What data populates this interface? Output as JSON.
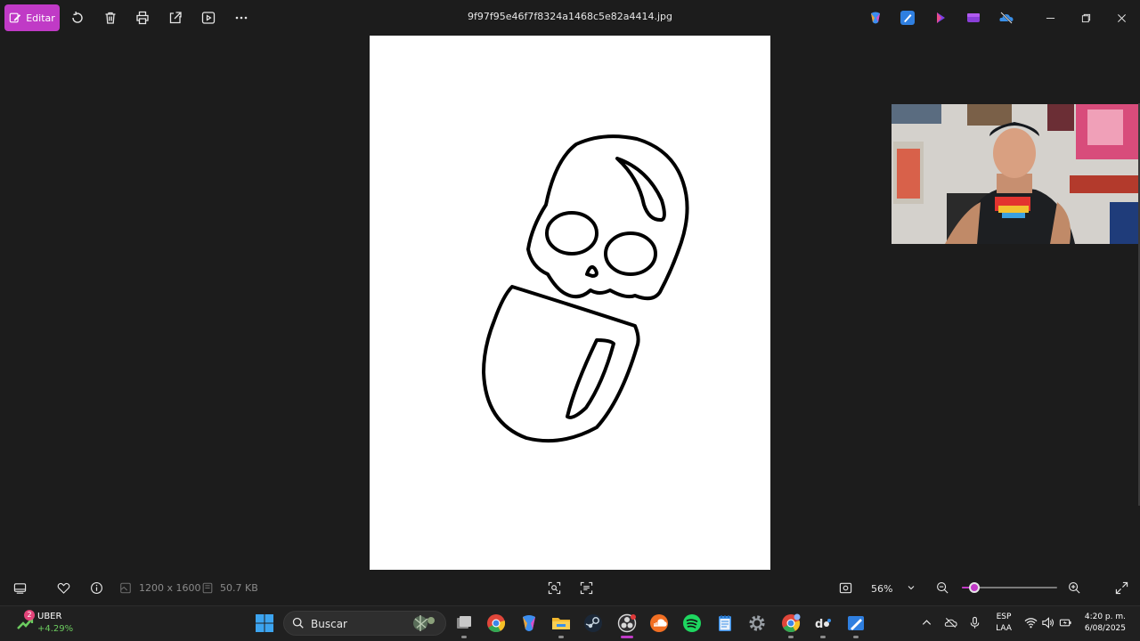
{
  "toolbar": {
    "edit_label": "Editar",
    "file_name": "9f97f95e46f7f8324a1468c5e82a4414.jpg"
  },
  "status": {
    "dimensions": "1200 x 1600",
    "file_size": "50.7 KB",
    "zoom": "56%",
    "zoom_fraction": 0.13
  },
  "taskbar": {
    "stock_name": "UBER",
    "stock_change": "+4.29%",
    "stock_badge": "2",
    "search_placeholder": "Buscar",
    "lang_top": "ESP",
    "lang_bottom": "LAA",
    "time": "4:20 p. m.",
    "date": "6/08/2025"
  },
  "colors": {
    "accent": "#c03ac6",
    "background": "#1c1c1c",
    "taskbar": "#202020"
  }
}
